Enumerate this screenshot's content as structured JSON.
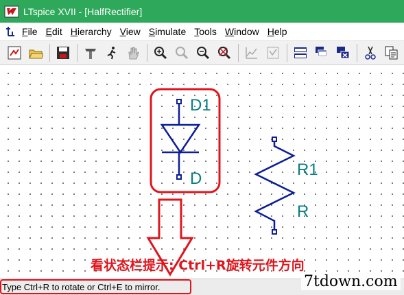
{
  "window": {
    "title": "LTspice XVII - [HalfRectifier]"
  },
  "menu": {
    "items": [
      {
        "label": "File",
        "mnemonic": "F",
        "rest": "ile"
      },
      {
        "label": "Edit",
        "mnemonic": "E",
        "rest": "dit"
      },
      {
        "label": "Hierarchy",
        "mnemonic": "H",
        "rest": "ierarchy"
      },
      {
        "label": "View",
        "mnemonic": "V",
        "rest": "iew"
      },
      {
        "label": "Simulate",
        "mnemonic": "S",
        "rest": "imulate"
      },
      {
        "label": "Tools",
        "mnemonic": "T",
        "rest": "ools"
      },
      {
        "label": "Window",
        "mnemonic": "W",
        "rest": "indow"
      },
      {
        "label": "Help",
        "mnemonic": "H",
        "rest": "elp"
      }
    ]
  },
  "toolbar": {
    "buttons": [
      "open-schematic-icon",
      "open-folder-icon",
      "save-icon",
      "control-panel-icon",
      "run-icon",
      "halt-icon",
      "zoom-in-icon",
      "pan-icon",
      "zoom-out-icon",
      "zoom-fit-icon",
      "autorange-icon",
      "waveform-icon",
      "tile-icon",
      "cascade-icon",
      "close-window-icon",
      "cut-icon",
      "copy-icon"
    ]
  },
  "schematic": {
    "diode": {
      "name": "D1",
      "value": "D"
    },
    "resistor": {
      "name": "R1",
      "value": "R"
    },
    "colors": {
      "component": "#0b1e96",
      "label": "#0a7d80",
      "pin": "#0b1e96"
    }
  },
  "annotation": {
    "text": "看状态栏提示: Ctrl+R旋转元件方向",
    "color": "#e0141b"
  },
  "status": {
    "text": "Type Ctrl+R to rotate or Ctrl+E to mirror."
  },
  "watermark": "7tdown.com"
}
